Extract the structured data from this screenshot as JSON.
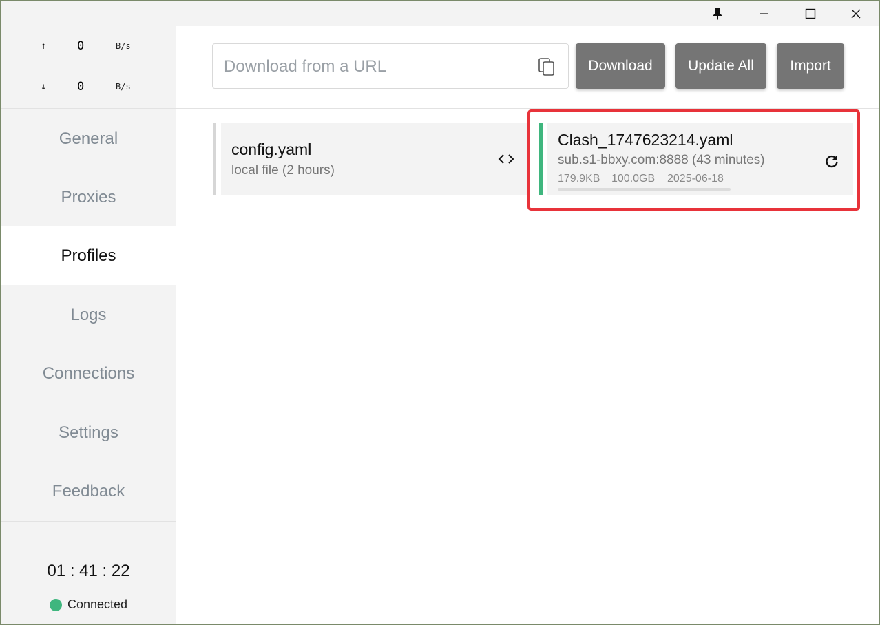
{
  "titlebar": {
    "icons": [
      "pin-icon",
      "minimize-icon",
      "maximize-icon",
      "close-icon"
    ]
  },
  "traffic": {
    "upload": {
      "arrow": "↑",
      "value": "0",
      "unit": "B/s"
    },
    "download": {
      "arrow": "↓",
      "value": "0",
      "unit": "B/s"
    }
  },
  "sidebar": {
    "items": [
      {
        "label": "General"
      },
      {
        "label": "Proxies"
      },
      {
        "label": "Profiles",
        "active": true
      },
      {
        "label": "Logs"
      },
      {
        "label": "Connections"
      },
      {
        "label": "Settings"
      },
      {
        "label": "Feedback"
      }
    ],
    "clock": "01 : 41 : 22",
    "status": {
      "label": "Connected",
      "color": "#3fb67e"
    }
  },
  "toolbar": {
    "url_placeholder": "Download from a URL",
    "url_value": "",
    "download_label": "Download",
    "update_all_label": "Update All",
    "import_label": "Import"
  },
  "profiles": [
    {
      "name": "config.yaml",
      "source": "local file (2 hours)",
      "bar_color": "#d6d6d6",
      "action_icon": "code-brackets-icon"
    },
    {
      "name": "Clash_1747623214.yaml",
      "source": "sub.s1-bbxy.com:8888 (43 minutes)",
      "size": "179.9KB",
      "quota": "100.0GB",
      "expires": "2025-06-18",
      "usage_fraction": 0.0,
      "bar_color": "#3fb67e",
      "action_icon": "refresh-icon",
      "selected": true
    }
  ],
  "colors": {
    "accent_active": "#3fb67e",
    "button_bg": "#757575",
    "highlight": "#e8333a"
  }
}
